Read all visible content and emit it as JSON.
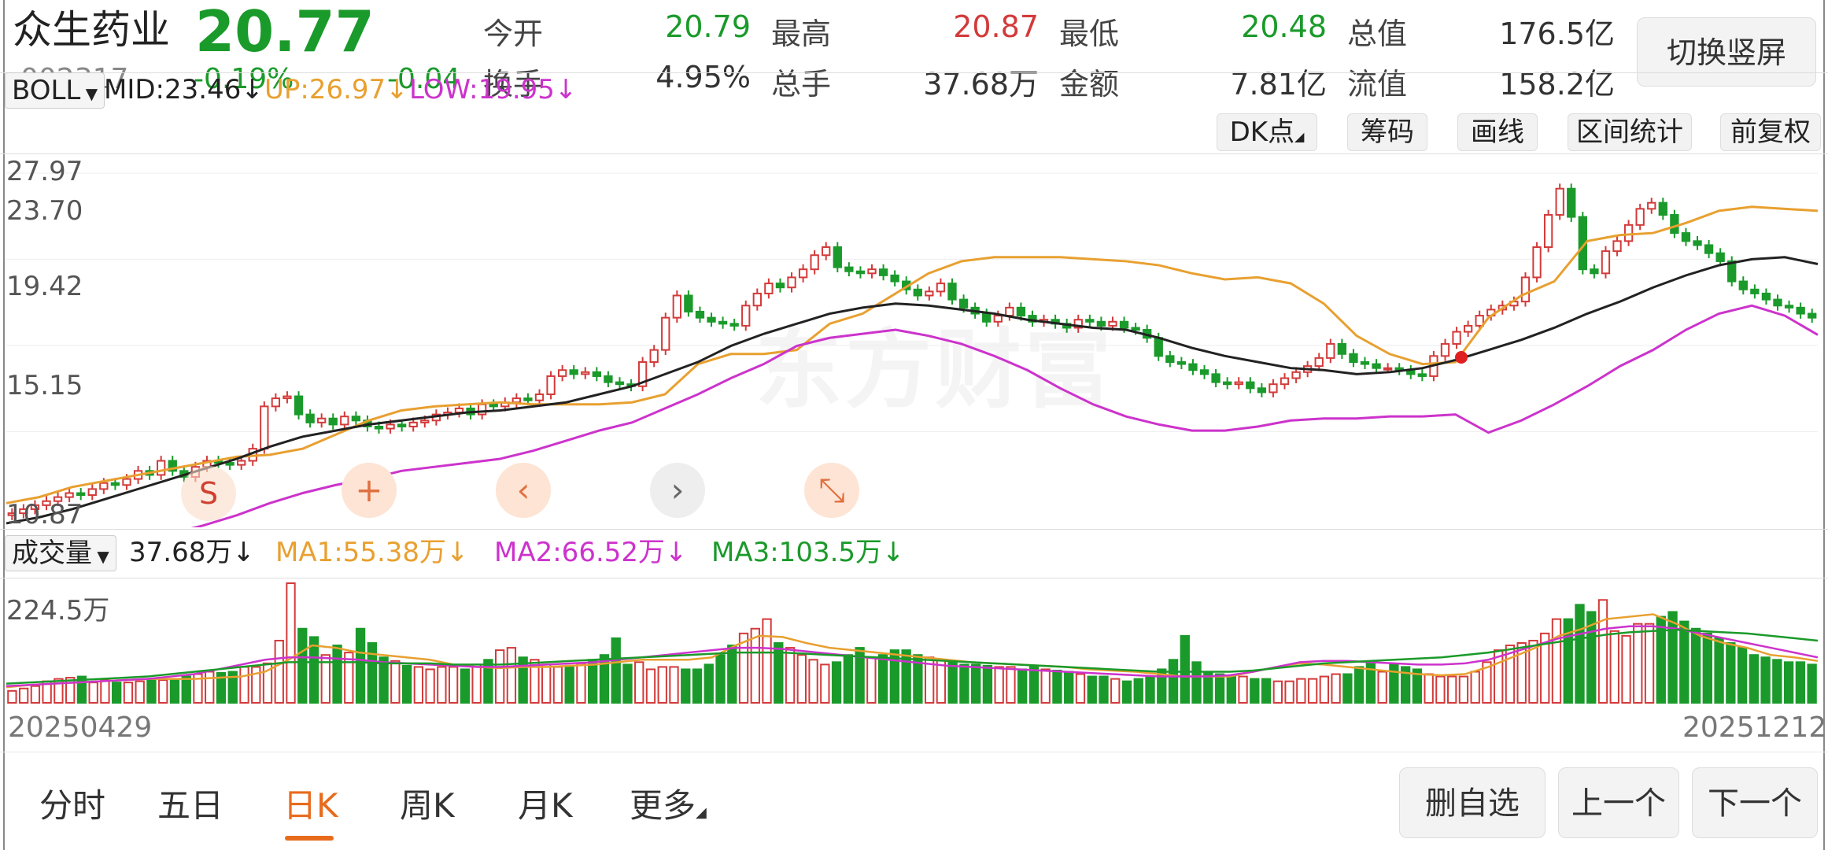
{
  "header": {
    "name": "众生药业",
    "price": "20.77",
    "code": "002317",
    "change_pct": "-0.19%",
    "change": "-0.04",
    "quotes": [
      {
        "label": "今开",
        "value": "20.79",
        "color": "green"
      },
      {
        "label": "最高",
        "value": "20.87",
        "color": "red"
      },
      {
        "label": "最低",
        "value": "20.48",
        "color": "green"
      },
      {
        "label": "总值",
        "value": "176.5亿",
        "color": "dark"
      },
      {
        "label": "换手",
        "value": "4.95%",
        "color": "dark"
      },
      {
        "label": "总手",
        "value": "37.68万",
        "color": "dark"
      },
      {
        "label": "金额",
        "value": "7.81亿",
        "color": "dark"
      },
      {
        "label": "流值",
        "value": "158.2亿",
        "color": "dark"
      }
    ],
    "switch_label": "切换竖屏"
  },
  "indicator": {
    "name": "BOLL",
    "mid": "MID:23.46",
    "up": "UP:26.97",
    "low": "LOW:19.95",
    "arrow": "↓",
    "tools": [
      "DK点",
      "筹码",
      "画线",
      "区间统计",
      "前复权"
    ]
  },
  "price_axis": [
    "27.97",
    "23.70",
    "19.42",
    "15.15",
    "10.87"
  ],
  "volume_bar": {
    "name": "成交量",
    "vol": "37.68万",
    "ma1": "MA1:55.38万",
    "ma2": "MA2:66.52万",
    "ma3": "MA3:103.5万",
    "arrow": "↓",
    "axis_label": "224.5万"
  },
  "dates": {
    "start": "20250429",
    "end": "20251212"
  },
  "watermark": "东方财富",
  "markers": {
    "s_label": "S"
  },
  "float_buttons": [
    {
      "icon": "plus-icon",
      "glyph": "+"
    },
    {
      "icon": "chevron-left-icon",
      "glyph": "‹"
    },
    {
      "icon": "chevron-right-icon",
      "glyph": "›"
    },
    {
      "icon": "compress-icon",
      "glyph": "⤡"
    }
  ],
  "tabs": [
    "分时",
    "五日",
    "日K",
    "周K",
    "月K",
    "更多"
  ],
  "active_tab": 2,
  "bottom_buttons": [
    "删自选",
    "上一个",
    "下一个"
  ],
  "colors": {
    "up": "#d33a3a",
    "down": "#1a9a2a",
    "mid": "#222222",
    "upper": "#e8a030",
    "lower": "#cc33cc",
    "accent": "#e86b1c"
  },
  "chart_data": {
    "type": "candlestick",
    "ylim": [
      10.87,
      27.97
    ],
    "close": [
      11.1,
      11.3,
      11.5,
      11.7,
      11.9,
      12.1,
      12.0,
      12.3,
      12.6,
      12.5,
      12.8,
      13.2,
      13.0,
      13.7,
      13.2,
      12.9,
      13.4,
      13.7,
      13.6,
      13.5,
      13.7,
      14.3,
      16.4,
      16.8,
      16.9,
      16.0,
      15.6,
      15.8,
      15.5,
      15.9,
      15.7,
      15.4,
      15.3,
      15.5,
      15.4,
      15.6,
      15.7,
      16.0,
      16.1,
      16.3,
      16.0,
      16.5,
      16.4,
      16.6,
      16.8,
      16.7,
      17.0,
      17.9,
      18.2,
      18.0,
      18.1,
      17.9,
      17.6,
      17.5,
      17.4,
      18.6,
      19.2,
      20.8,
      21.9,
      21.1,
      20.8,
      20.6,
      20.5,
      20.4,
      21.4,
      22.0,
      22.5,
      22.3,
      22.8,
      23.2,
      23.9,
      24.3,
      23.3,
      23.1,
      23.0,
      23.2,
      22.9,
      22.6,
      22.2,
      21.9,
      22.1,
      22.5,
      21.7,
      21.3,
      21.0,
      20.6,
      20.9,
      21.3,
      20.9,
      20.6,
      20.7,
      20.5,
      20.3,
      20.7,
      20.6,
      20.4,
      20.6,
      20.3,
      20.2,
      19.8,
      18.9,
      18.6,
      18.5,
      18.2,
      18.0,
      17.6,
      17.5,
      17.6,
      17.3,
      17.1,
      17.5,
      17.8,
      18.1,
      18.4,
      18.8,
      19.5,
      19.0,
      18.6,
      18.5,
      18.3,
      18.3,
      18.2,
      18.0,
      17.9,
      18.9,
      19.5,
      20.1,
      20.4,
      20.9,
      21.2,
      21.4,
      21.6,
      22.8,
      24.3,
      25.9,
      27.2,
      25.8,
      23.2,
      23.0,
      24.1,
      24.6,
      25.4,
      26.2,
      26.5,
      25.9,
      25.0,
      24.6,
      24.4,
      24.0,
      23.6,
      22.6,
      22.2,
      22.0,
      21.7,
      21.4,
      21.3,
      21.0,
      20.8
    ],
    "bollinger": {
      "upper": [
        11.6,
        11.9,
        12.4,
        12.7,
        13.0,
        13.3,
        13.6,
        13.9,
        14.0,
        14.3,
        15.0,
        15.7,
        16.2,
        16.4,
        16.5,
        16.6,
        16.5,
        16.5,
        16.5,
        16.6,
        17.0,
        18.5,
        19.0,
        19.0,
        19.2,
        20.5,
        21.0,
        22.0,
        23.0,
        23.6,
        23.8,
        23.8,
        23.8,
        23.7,
        23.6,
        23.4,
        23.0,
        22.7,
        22.8,
        22.5,
        21.5,
        19.9,
        19.0,
        18.5,
        18.6,
        20.8,
        21.9,
        22.6,
        24.6,
        24.9,
        25.0,
        25.5,
        26.1,
        26.3,
        26.2,
        26.1
      ],
      "mid": [
        10.6,
        10.9,
        11.3,
        11.8,
        12.3,
        12.8,
        13.3,
        13.8,
        14.4,
        14.9,
        15.2,
        15.5,
        15.7,
        15.9,
        16.1,
        16.2,
        16.4,
        16.6,
        17.0,
        17.4,
        18.0,
        18.6,
        19.4,
        20.0,
        20.5,
        21.0,
        21.3,
        21.5,
        21.4,
        21.2,
        21.0,
        20.7,
        20.5,
        20.3,
        20.2,
        19.8,
        19.3,
        18.9,
        18.6,
        18.3,
        18.2,
        18.0,
        18.1,
        18.3,
        18.7,
        19.2,
        19.7,
        20.3,
        21.0,
        21.6,
        22.3,
        22.9,
        23.4,
        23.7,
        23.8,
        23.46
      ],
      "lower": [
        9.7,
        9.6,
        9.5,
        9.7,
        9.9,
        10.1,
        10.5,
        11.0,
        11.6,
        12.1,
        12.5,
        12.8,
        13.2,
        13.4,
        13.6,
        13.8,
        14.2,
        14.7,
        15.2,
        15.6,
        16.3,
        17.0,
        17.8,
        18.5,
        19.4,
        19.8,
        20.0,
        20.2,
        19.9,
        19.5,
        18.9,
        18.2,
        17.3,
        16.5,
        15.9,
        15.5,
        15.2,
        15.2,
        15.4,
        15.7,
        15.8,
        15.8,
        15.9,
        15.9,
        16.0,
        15.1,
        15.7,
        16.5,
        17.4,
        18.4,
        19.2,
        20.2,
        21.0,
        21.4,
        20.9,
        19.95
      ]
    },
    "volume": [
      10,
      12,
      14,
      18,
      20,
      21,
      22,
      17,
      19,
      17,
      17,
      18,
      20,
      19,
      20,
      22,
      24,
      26,
      25,
      26,
      30,
      30,
      33,
      52,
      100,
      62,
      55,
      40,
      48,
      42,
      62,
      50,
      38,
      35,
      31,
      30,
      28,
      30,
      30,
      28,
      32,
      36,
      44,
      46,
      38,
      36,
      32,
      30,
      31,
      33,
      36,
      40,
      54,
      32,
      34,
      28,
      30,
      30,
      28,
      28,
      32,
      40,
      48,
      58,
      62,
      70,
      50,
      46,
      40,
      36,
      32,
      34,
      40,
      46,
      38,
      40,
      44,
      44,
      40,
      38,
      36,
      34,
      32,
      32,
      31,
      30,
      30,
      28,
      30,
      28,
      27,
      26,
      24,
      22,
      22,
      20,
      18,
      20,
      22,
      28,
      36,
      56,
      34,
      26,
      24,
      22,
      22,
      20,
      20,
      18,
      18,
      20,
      20,
      22,
      24,
      24,
      30,
      34,
      26,
      32,
      30,
      28,
      24,
      22,
      22,
      22,
      26,
      34,
      44,
      48,
      50,
      52,
      58,
      70,
      70,
      82,
      76,
      86,
      60,
      56,
      66,
      66,
      72,
      76,
      68,
      62,
      58,
      54,
      50,
      46,
      40,
      38,
      36,
      34,
      34,
      32
    ],
    "vol_ma1": [
      13,
      15,
      16,
      17,
      18,
      19,
      20,
      20,
      20,
      21,
      22,
      26,
      36,
      48,
      46,
      42,
      40,
      38,
      36,
      32,
      30,
      29,
      30,
      30,
      31,
      32,
      34,
      36,
      36,
      36,
      38,
      48,
      56,
      55,
      50,
      46,
      44,
      42,
      40,
      38,
      36,
      34,
      33,
      32,
      31,
      30,
      28,
      27,
      26,
      24,
      22,
      22,
      22,
      26,
      30,
      33,
      32,
      30,
      28,
      26,
      24,
      23,
      24,
      30,
      38,
      46,
      56,
      62,
      70,
      72,
      74,
      66,
      56,
      50,
      46,
      40,
      38,
      35
    ],
    "vol_ma2": [
      14,
      15,
      16,
      17,
      18,
      19,
      20,
      22,
      24,
      28,
      32,
      36,
      38,
      38,
      37,
      36,
      34,
      33,
      32,
      31,
      30,
      30,
      31,
      32,
      33,
      34,
      36,
      38,
      40,
      42,
      44,
      46,
      46,
      45,
      43,
      41,
      39,
      37,
      35,
      33,
      31,
      30,
      29,
      28,
      27,
      26,
      25,
      24,
      23,
      22,
      22,
      22,
      23,
      26,
      30,
      34,
      35,
      35,
      34,
      33,
      32,
      32,
      33,
      36,
      42,
      48,
      54,
      58,
      62,
      64,
      64,
      62,
      58,
      54,
      50,
      46,
      42,
      38
    ],
    "vol_ma3": [
      16,
      17,
      18,
      19,
      20,
      21,
      22,
      24,
      26,
      28,
      30,
      32,
      34,
      34,
      34,
      34,
      33,
      33,
      33,
      32,
      32,
      32,
      33,
      34,
      35,
      36,
      37,
      38,
      39,
      40,
      41,
      42,
      42,
      42,
      41,
      40,
      39,
      38,
      37,
      36,
      35,
      34,
      33,
      32,
      31,
      30,
      29,
      28,
      27,
      26,
      26,
      26,
      26,
      27,
      29,
      31,
      33,
      34,
      35,
      36,
      37,
      38,
      40,
      42,
      45,
      48,
      51,
      54,
      57,
      59,
      60,
      61,
      60,
      59,
      58,
      56,
      54,
      52
    ]
  }
}
